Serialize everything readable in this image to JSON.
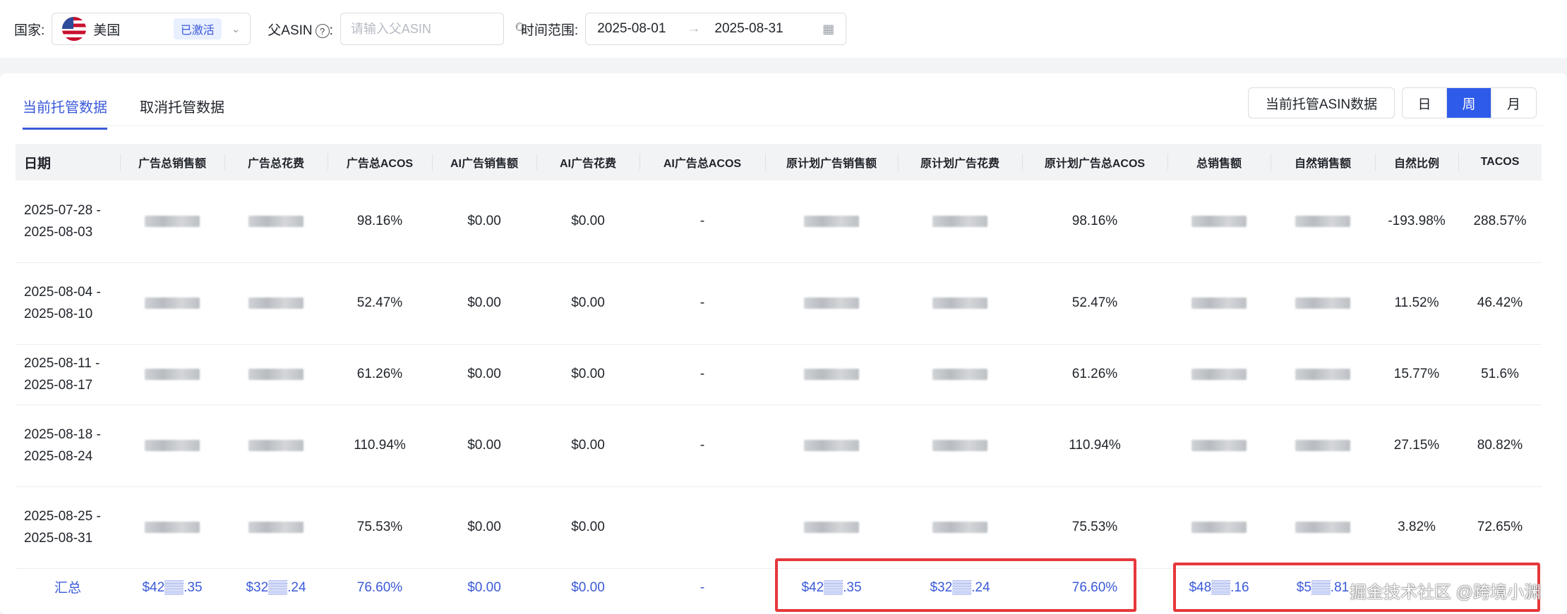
{
  "filters": {
    "country_label": "国家:",
    "country_value": "美国",
    "country_status": "已激活",
    "asin_label": "父ASIN",
    "asin_colon": ":",
    "asin_placeholder": "请输入父ASIN",
    "time_label": "时间范围:",
    "date_start": "2025-08-01",
    "date_end": "2025-08-31"
  },
  "tabs": [
    {
      "label": "当前托管数据",
      "active": true
    },
    {
      "label": "取消托管数据",
      "active": false
    }
  ],
  "toolbar": {
    "export_label": "当前托管ASIN数据",
    "granularity": [
      "日",
      "周",
      "月"
    ],
    "granularity_selected": "周"
  },
  "table": {
    "headers": [
      "日期",
      "广告总销售额",
      "广告总花费",
      "广告总ACOS",
      "AI广告销售额",
      "AI广告花费",
      "AI广告总ACOS",
      "原计划广告销售额",
      "原计划广告花费",
      "原计划广告总ACOS",
      "总销售额",
      "自然销售额",
      "自然比例",
      "TACOS"
    ],
    "rows": [
      {
        "date": "2025-07-28 - 2025-08-03",
        "ad_acos": "98.16%",
        "ai_sales": "$0.00",
        "ai_spend": "$0.00",
        "ai_acos": "-",
        "orig_acos": "98.16%",
        "natural_ratio": "-193.98%",
        "tacos": "288.57%"
      },
      {
        "date": "2025-08-04 - 2025-08-10",
        "ad_acos": "52.47%",
        "ai_sales": "$0.00",
        "ai_spend": "$0.00",
        "ai_acos": "-",
        "orig_acos": "52.47%",
        "natural_ratio": "11.52%",
        "tacos": "46.42%"
      },
      {
        "date": "2025-08-11 - 2025-08-17",
        "ad_acos": "61.26%",
        "ai_sales": "$0.00",
        "ai_spend": "$0.00",
        "ai_acos": "-",
        "orig_acos": "61.26%",
        "natural_ratio": "15.77%",
        "tacos": "51.6%"
      },
      {
        "date": "2025-08-18 - 2025-08-24",
        "ad_acos": "110.94%",
        "ai_sales": "$0.00",
        "ai_spend": "$0.00",
        "ai_acos": "-",
        "orig_acos": "110.94%",
        "natural_ratio": "27.15%",
        "tacos": "80.82%"
      },
      {
        "date": "2025-08-25 - 2025-08-31",
        "ad_acos": "75.53%",
        "ai_sales": "$0.00",
        "ai_spend": "$0.00",
        "ai_acos": "",
        "orig_acos": "75.53%",
        "natural_ratio": "3.82%",
        "tacos": "72.65%"
      }
    ],
    "total": {
      "label": "汇总",
      "ad_sales": "$42▒▒.35",
      "ad_spend": "$32▒▒.24",
      "ad_acos": "76.60%",
      "ai_sales": "$0.00",
      "ai_spend": "$0.00",
      "ai_acos": "-",
      "orig_sales": "$42▒▒.35",
      "orig_spend": "$32▒▒.24",
      "orig_acos": "76.60%",
      "total_sales": "$48▒▒.16",
      "natural_sales": "$5▒▒.81"
    }
  },
  "watermark": "掘金技术社区 @跨境小渊",
  "colors": {
    "accent": "#2f5bea",
    "highlight_box": "#e5383b"
  }
}
